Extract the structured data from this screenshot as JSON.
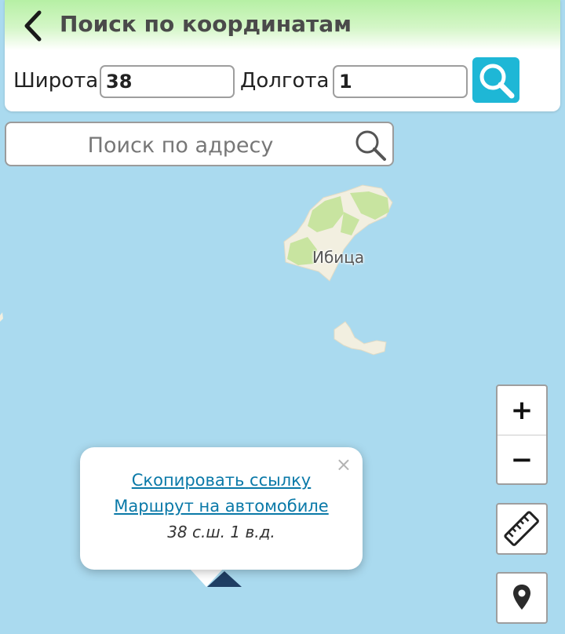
{
  "header": {
    "title": "Поиск по координатам",
    "back_icon": "chevron-left-icon",
    "latitude_label": "Широта",
    "latitude_value": "38",
    "longitude_label": "Долгота",
    "longitude_value": "1",
    "search_icon": "search-icon",
    "accent_color": "#1eb7d6"
  },
  "address_search": {
    "placeholder": "Поиск по адресу",
    "icon": "search-icon"
  },
  "map": {
    "place_label": "Ибица",
    "water_color": "#aadaef",
    "land_color": "#f2efe0",
    "forest_color": "#c8e4a0"
  },
  "controls": {
    "zoom_in": "+",
    "zoom_out": "−",
    "ruler_icon": "ruler-icon",
    "location_icon": "map-pin-icon"
  },
  "popup": {
    "close": "×",
    "copy_link": "Скопировать ссылку",
    "route_link": "Маршрут на автомобиле",
    "coords_text": "38 с.ш. 1 в.д."
  }
}
